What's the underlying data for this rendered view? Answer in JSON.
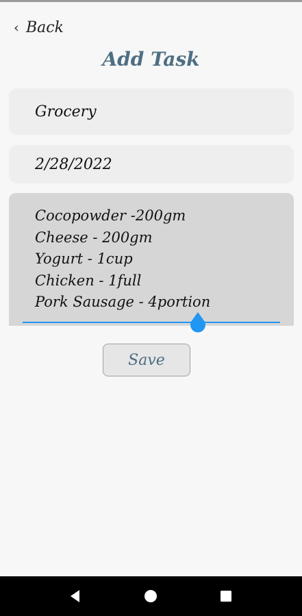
{
  "header": {
    "back_label": "Back",
    "title": "Add Task"
  },
  "form": {
    "task_name": "Grocery",
    "date": "2/28/2022",
    "notes": [
      "Cocopowder -200gm",
      "Cheese - 200gm",
      "Yogurt - 1cup",
      "Chicken - 1full",
      "Pork Sausage - 4portion"
    ],
    "save_label": "Save"
  },
  "colors": {
    "accent": "#2196f3",
    "title": "#4e6e82",
    "background": "#f7f7f7"
  },
  "icons": {
    "back": "chevron-left-icon",
    "nav_back": "triangle-back-icon",
    "nav_home": "circle-home-icon",
    "nav_recent": "square-recents-icon"
  }
}
